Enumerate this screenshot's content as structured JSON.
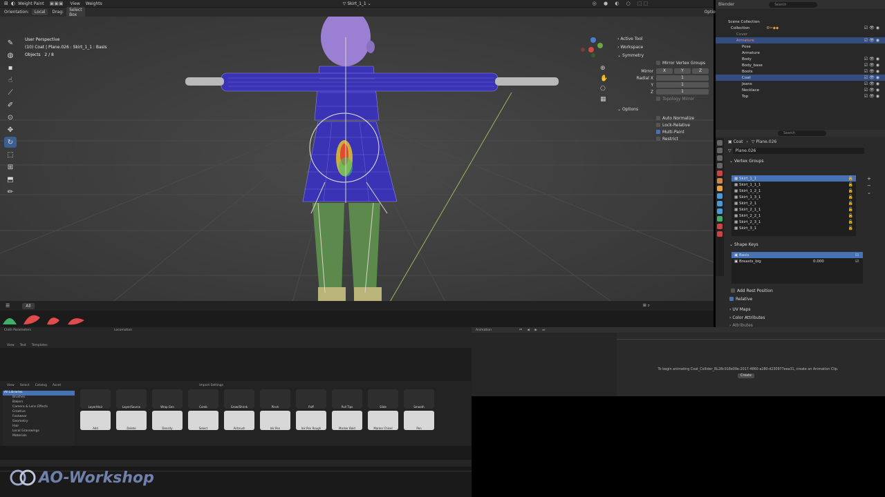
{
  "header": {
    "mode": "Weight Paint",
    "menus": [
      "View",
      "Weights"
    ],
    "orientation_label": "Orientation:",
    "orientation_value": "Local",
    "drag_label": "Drag:",
    "drag_value": "Select Box",
    "active_vertex_group": "Skirt_1_1",
    "options_label": "Options"
  },
  "viewport": {
    "view_name": "User Perspective",
    "object_line": "(10) Coat | Plane.026 : Skirt_1_1 : Basis",
    "objects_label": "Objects",
    "objects_count": "2 / 8"
  },
  "tool_panel": {
    "active_tool": "Active Tool",
    "workspace": "Workspace",
    "symmetry": "Symmetry",
    "mirror_vertex_groups": "Mirror Vertex Groups",
    "mirror_label": "Mirror",
    "axes": [
      "X",
      "Y",
      "Z"
    ],
    "radial_x": "Radial X",
    "radial_y": "Y",
    "radial_z": "Z",
    "radial_values": [
      "1",
      "1",
      "1"
    ],
    "topology_mirror": "Topology Mirror",
    "options": "Options",
    "auto_normalize": "Auto Normalize",
    "lock_relative": "Lock-Relative",
    "multi_paint": "Multi-Paint",
    "restrict": "Restrict"
  },
  "outliner": {
    "title": "Blender",
    "search_placeholder": "Search",
    "items": [
      {
        "label": "Scene Collection",
        "selected": false
      },
      {
        "label": "Collection",
        "selected": false
      },
      {
        "label": "Cover",
        "selected": false
      },
      {
        "label": "Armature",
        "selected": true
      },
      {
        "label": "Pose",
        "selected": false
      },
      {
        "label": "Armature",
        "selected": false
      },
      {
        "label": "Body",
        "selected": false
      },
      {
        "label": "Body_base",
        "selected": false
      },
      {
        "label": "Boots",
        "selected": false
      },
      {
        "label": "Coat",
        "selected": true
      },
      {
        "label": "Jeans",
        "selected": false
      },
      {
        "label": "Necklace",
        "selected": false
      },
      {
        "label": "Top",
        "selected": false
      }
    ]
  },
  "properties": {
    "breadcrumb_object": "Coat",
    "breadcrumb_mesh": "Plane.026",
    "mesh_name": "Plane.026",
    "search_placeholder": "Search",
    "vertex_groups_title": "Vertex Groups",
    "vertex_groups": [
      "Skirt_1_1",
      "Skirt_1_1_1",
      "Skirt_1_2_1",
      "Skirt_1_3_1",
      "Skirt_2_1",
      "Skirt_2_1_1",
      "Skirt_2_2_1",
      "Skirt_2_3_1",
      "Skirt_3_1"
    ],
    "shape_keys_title": "Shape Keys",
    "shape_keys": [
      {
        "name": "Basis",
        "value": ""
      },
      {
        "name": "Breasts_big",
        "value": "0.000"
      }
    ],
    "add_rest_position": "Add Rest Position",
    "relative": "Relative",
    "uv_maps": "UV Maps",
    "color_attributes": "Color Attributes",
    "attributes": "Attributes"
  },
  "bottom": {
    "all_tab": "All",
    "anim_title": "Animation",
    "anim_tabs": [
      "Cloth Parameters",
      "Locomotion"
    ],
    "editor_menus": [
      "View",
      "Text",
      "Templates"
    ],
    "asset_menus": [
      "View",
      "Select",
      "Catalog",
      "Asset"
    ],
    "import_settings": "Import Settings",
    "asset_tree": [
      "All Libraries",
      "Brushes",
      "Bakers",
      "Camera & Lens Effects",
      "Creative",
      "Footwear",
      "Geometry",
      "Hair",
      "Local Grasswings",
      "Materials"
    ],
    "brushes_row1": [
      "Layer/Hair",
      "Layer/Source",
      "Wrap Gen",
      "Comb",
      "Grow/Shrink",
      "Pinch",
      "Puff",
      "Pull Tips",
      "Slide",
      "Smooth"
    ],
    "brushes_row2": [
      "Add",
      "Delete",
      "Density",
      "Select",
      "Airbrush",
      "Ink Pen",
      "Ink Pen Rough",
      "Marker Bold",
      "Marker Chisel",
      "Pen"
    ],
    "timeline_message": "To begin animating Coat_Collider_RL28c918e09e-2017-4860-a280-d230977eea31, create an Animation Clip.",
    "create_button": "Create"
  },
  "watermark": "AO-Workshop",
  "colors": {
    "accent": "#4772b3",
    "selection": "#334d80",
    "body_green": "#5b8a4c",
    "coat_blue": "#3a33b5",
    "head_purple": "#9b7fd2"
  }
}
